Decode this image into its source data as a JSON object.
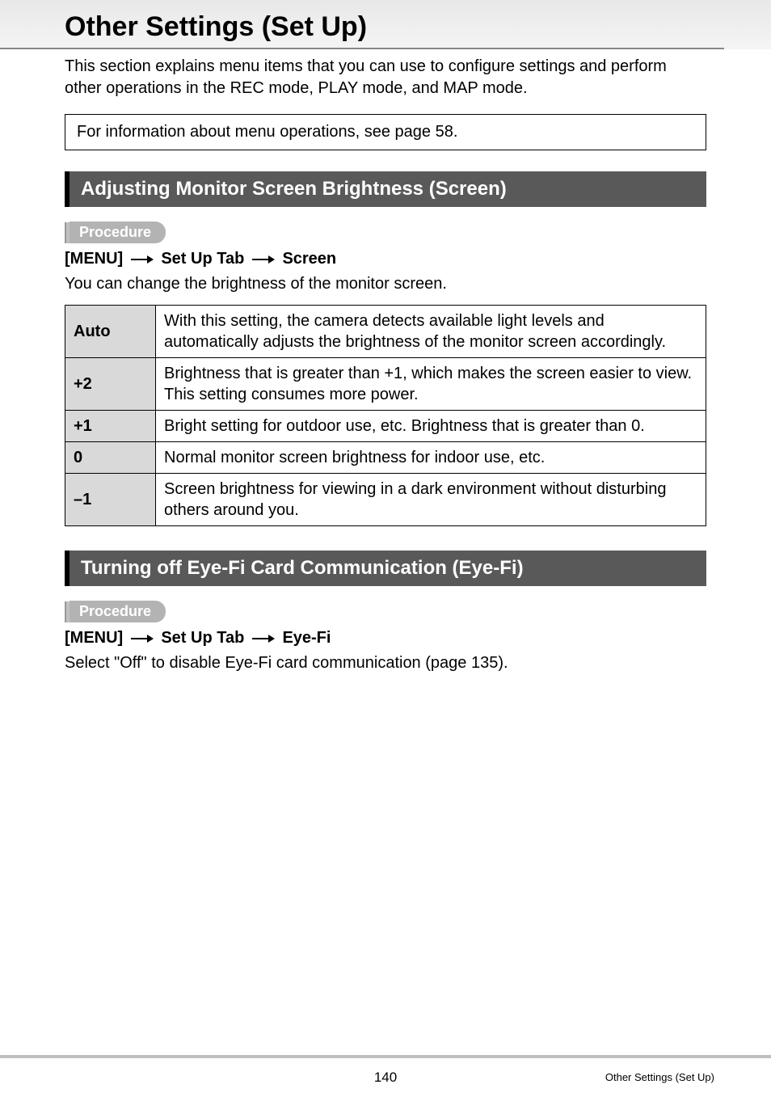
{
  "page": {
    "title": "Other Settings (Set Up)",
    "intro": "This section explains menu items that you can use to configure settings and perform other operations in the REC mode, PLAY mode, and MAP mode.",
    "infoBox": "For information about menu operations, see page 58."
  },
  "section1": {
    "heading": "Adjusting Monitor Screen Brightness (Screen)",
    "procedureLabel": "Procedure",
    "path": {
      "p1": "[MENU]",
      "p2": "Set Up Tab",
      "p3": "Screen"
    },
    "desc": "You can change the brightness of the monitor screen.",
    "rows": [
      {
        "key": "Auto",
        "val": "With this setting, the camera detects available light levels and automatically adjusts the brightness of the monitor screen accordingly."
      },
      {
        "key": "+2",
        "val": "Brightness that is greater than +1, which makes the screen easier to view. This setting consumes more power."
      },
      {
        "key": "+1",
        "val": "Bright setting for outdoor use, etc. Brightness that is greater than 0."
      },
      {
        "key": "0",
        "val": "Normal monitor screen brightness for indoor use, etc."
      },
      {
        "key": "–1",
        "val": "Screen brightness for viewing in a dark environment without disturbing others around you."
      }
    ]
  },
  "section2": {
    "heading": "Turning off Eye-Fi Card Communication (Eye-Fi)",
    "procedureLabel": "Procedure",
    "path": {
      "p1": "[MENU]",
      "p2": "Set Up Tab",
      "p3": "Eye-Fi"
    },
    "desc": "Select \"Off\" to disable Eye-Fi card communication (page 135)."
  },
  "footer": {
    "pageNum": "140",
    "sectionName": "Other Settings (Set Up)"
  }
}
